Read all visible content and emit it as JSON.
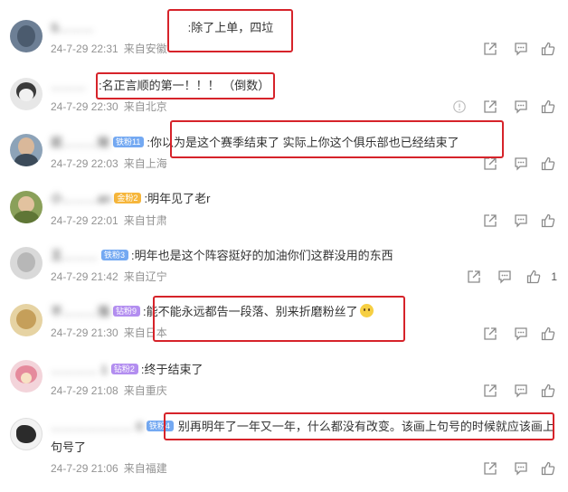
{
  "comments": [
    {
      "user": "S………",
      "badge": "",
      "text": ":除了上单，四垃",
      "date": "24-7-29 22:31",
      "source": "来自安徽",
      "likes": ""
    },
    {
      "user": "………",
      "badge": "",
      "text": ":名正言顺的第一！！！ （倒数）",
      "date": "24-7-29 22:30",
      "source": "来自北京",
      "likes": ""
    },
    {
      "user": "屁………陵",
      "badge": "铁粉11",
      "text": ":你以为是这个赛季结束了 实际上你这个俱乐部也已经结束了",
      "date": "24-7-29 22:03",
      "source": "来自上海",
      "likes": ""
    },
    {
      "user": "小………an",
      "badge": "金粉2",
      "text": ":明年见了老r",
      "date": "24-7-29 22:01",
      "source": "来自甘肃",
      "likes": ""
    },
    {
      "user": "王………",
      "badge": "铁粉3",
      "text": ":明年也是这个阵容挺好的加油你们这群没用的东西",
      "date": "24-7-29 21:42",
      "source": "来自辽宁",
      "likes": "1"
    },
    {
      "user": "不………强",
      "badge": "钻粉9",
      "text": ":能不能永远都告一段落、别来折磨粉丝了",
      "date": "24-7-29 21:30",
      "source": "来自日本",
      "likes": ""
    },
    {
      "user": "………… 1",
      "badge": "钻粉2",
      "text": ":终于结束了",
      "date": "24-7-29 21:08",
      "source": "来自重庆",
      "likes": ""
    },
    {
      "user": "………………… 0",
      "badge": "铁粉4",
      "text": "别再明年了一年又一年，什么都没有改变。该画上句号的时候就应该画上",
      "text2": "句号了",
      "date": "24-7-29 21:06",
      "source": "来自福建",
      "likes": ""
    }
  ],
  "icons": {
    "share": "share-icon",
    "reply": "comment-icon",
    "like": "thumbs-up-icon",
    "info": "report-icon"
  },
  "colors": {
    "highlight": "#d6232a",
    "meta": "#939393",
    "badge_blue": "#74a9f2",
    "badge_gold": "#f6b63b",
    "badge_purple": "#b38ef0"
  }
}
